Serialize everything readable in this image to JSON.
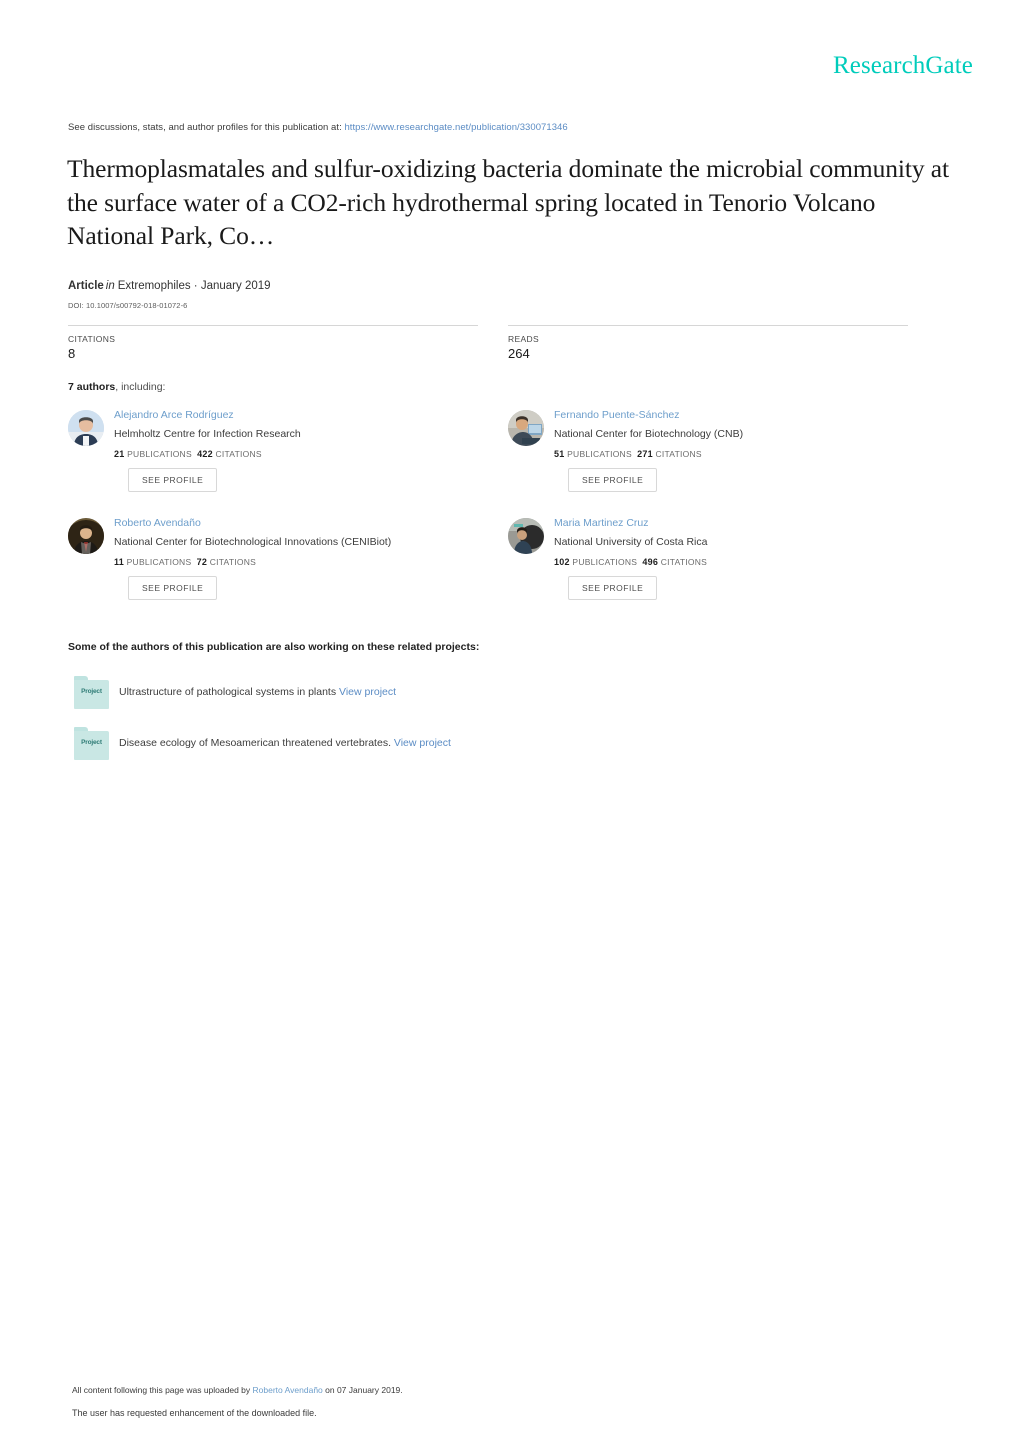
{
  "brand": {
    "logo_text": "ResearchGate",
    "logo_color": "#00ccbb"
  },
  "intro": {
    "prefix": "See discussions, stats, and author profiles for this publication at: ",
    "url": "https://www.researchgate.net/publication/330071346"
  },
  "publication": {
    "title": "Thermoplasmatales and sulfur-oxidizing bacteria dominate the microbial community at the surface water of a CO2-rich hydrothermal spring located in Tenorio Volcano National Park, Co…",
    "type_label": "Article",
    "in_label": "in",
    "venue": "Extremophiles · January 2019",
    "doi": "DOI: 10.1007/s00792-018-01072-6"
  },
  "stats": {
    "citations_label": "CITATIONS",
    "citations_value": "8",
    "reads_label": "READS",
    "reads_value": "264"
  },
  "authors_section": {
    "count_label": "7 authors",
    "suffix": ", including:",
    "see_profile_label": "SEE PROFILE",
    "publications_label": "PUBLICATIONS",
    "citations_label": "CITATIONS",
    "authors": [
      {
        "name": "Alejandro Arce Rodríguez",
        "affiliation": "Helmholtz Centre for Infection Research",
        "publications": "21",
        "citations": "422"
      },
      {
        "name": "Fernando Puente-Sánchez",
        "affiliation": "National Center for Biotechnology (CNB)",
        "publications": "51",
        "citations": "271"
      },
      {
        "name": "Roberto Avendaño",
        "affiliation": "National Center for Biotechnological Innovations (CENIBiot)",
        "publications": "11",
        "citations": "72"
      },
      {
        "name": "Maria Martinez Cruz",
        "affiliation": "National University of Costa Rica",
        "publications": "102",
        "citations": "496"
      }
    ]
  },
  "projects_section": {
    "heading": "Some of the authors of this publication are also working on these related projects:",
    "folder_label": "Project",
    "view_link_label": "View project",
    "projects": [
      {
        "title": "Ultrastructure of pathological systems in plants"
      },
      {
        "title": "Disease ecology of Mesoamerican threatened vertebrates."
      }
    ]
  },
  "footer": {
    "line1_prefix": "All content following this page was uploaded by ",
    "line1_link": "Roberto Avendaño",
    "line1_suffix": " on 07 January 2019.",
    "line2": "The user has requested enhancement of the downloaded file."
  }
}
